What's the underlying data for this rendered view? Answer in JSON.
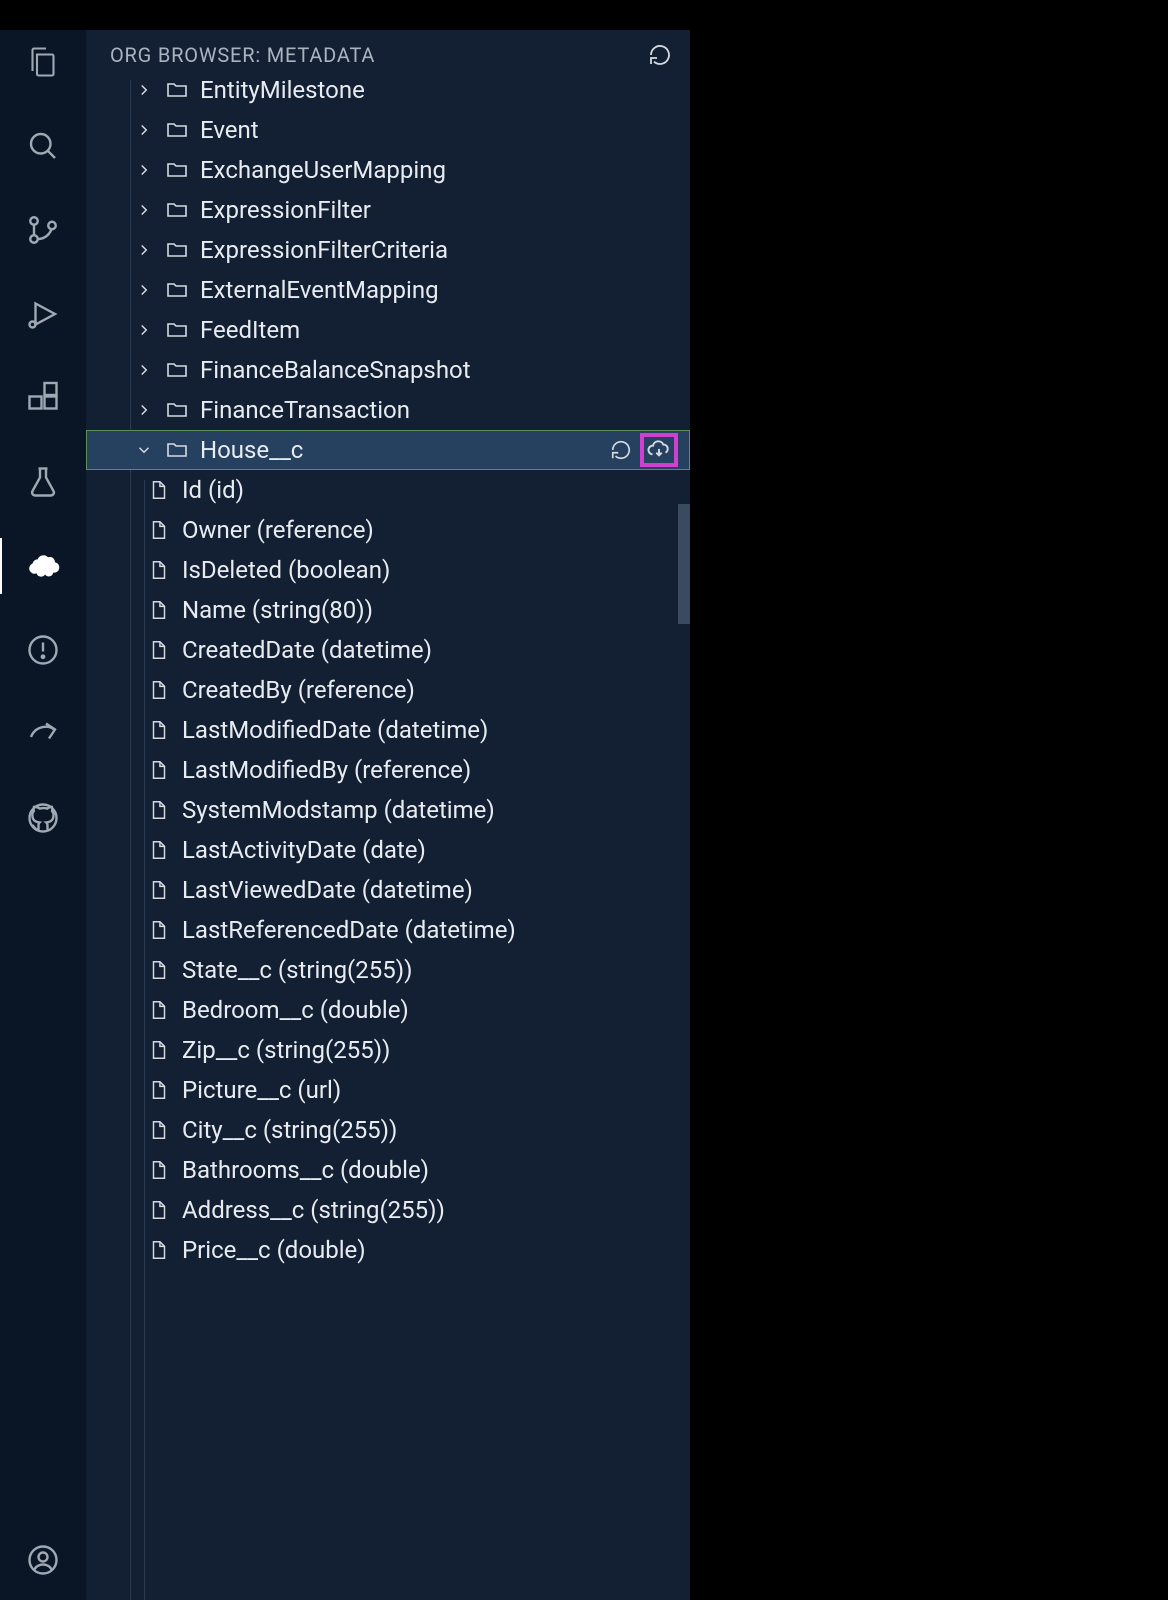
{
  "sidebar": {
    "title": "ORG BROWSER: METADATA"
  },
  "tree": {
    "folders": [
      {
        "label": "EntityMilestone",
        "expanded": false
      },
      {
        "label": "Event",
        "expanded": false
      },
      {
        "label": "ExchangeUserMapping",
        "expanded": false
      },
      {
        "label": "ExpressionFilter",
        "expanded": false
      },
      {
        "label": "ExpressionFilterCriteria",
        "expanded": false
      },
      {
        "label": "ExternalEventMapping",
        "expanded": false
      },
      {
        "label": "FeedItem",
        "expanded": false
      },
      {
        "label": "FinanceBalanceSnapshot",
        "expanded": false
      },
      {
        "label": "FinanceTransaction",
        "expanded": false
      },
      {
        "label": "House__c",
        "expanded": true,
        "selected": true
      }
    ],
    "fields": [
      {
        "label": "Id (id)"
      },
      {
        "label": "Owner (reference)"
      },
      {
        "label": "IsDeleted (boolean)"
      },
      {
        "label": "Name (string(80))"
      },
      {
        "label": "CreatedDate (datetime)"
      },
      {
        "label": "CreatedBy (reference)"
      },
      {
        "label": "LastModifiedDate (datetime)"
      },
      {
        "label": "LastModifiedBy (reference)"
      },
      {
        "label": "SystemModstamp (datetime)"
      },
      {
        "label": "LastActivityDate (date)"
      },
      {
        "label": "LastViewedDate (datetime)"
      },
      {
        "label": "LastReferencedDate (datetime)"
      },
      {
        "label": "State__c (string(255))"
      },
      {
        "label": "Bedroom__c (double)"
      },
      {
        "label": "Zip__c (string(255))"
      },
      {
        "label": "Picture__c (url)"
      },
      {
        "label": "City__c (string(255))"
      },
      {
        "label": "Bathrooms__c (double)"
      },
      {
        "label": "Address__c (string(255))"
      },
      {
        "label": "Price__c (double)"
      }
    ]
  }
}
